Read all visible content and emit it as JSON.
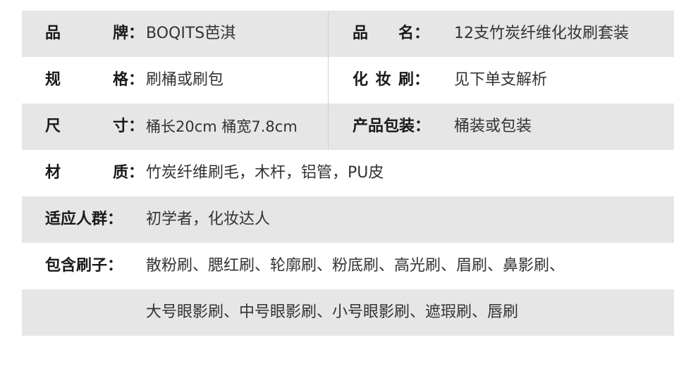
{
  "rows": [
    {
      "label_l": "品牌：",
      "value_l": "BOQITS芭淇",
      "label_r": "品名：",
      "value_r": "12支竹炭纤维化妆刷套装"
    },
    {
      "label_l": "规格：",
      "value_l": "刷桶或刷包",
      "label_r": "化妆刷：",
      "value_r": "见下单支解析"
    },
    {
      "label_l": "尺寸：",
      "value_l": "桶长20cm 桶宽7.8cm",
      "label_r": "产品包装：",
      "value_r": "桶装或包装"
    },
    {
      "label": "材质：",
      "value": "竹炭纤维刷毛，木杆，铝管，PU皮"
    },
    {
      "label": "适应人群：",
      "value": "初学者，化妆达人"
    },
    {
      "label": "包含刷子：",
      "value": "散粉刷、腮红刷、轮廓刷、粉底刷、高光刷、眉刷、鼻影刷、"
    },
    {
      "value": "大号眼影刷、中号眼影刷、小号眼影刷、遮瑕刷、唇刷"
    }
  ]
}
